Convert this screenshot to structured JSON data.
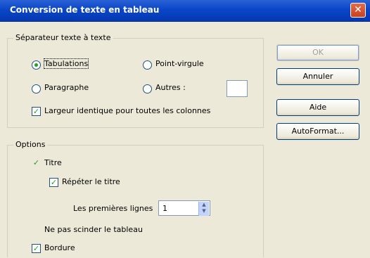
{
  "window": {
    "title": "Conversion de texte en tableau",
    "close_glyph": "✕"
  },
  "separator_group": {
    "legend": "Séparateur texte à texte",
    "tabulations": "Tabulations",
    "point_virgule": "Point-virgule",
    "paragraphe": "Paragraphe",
    "autres": "Autres :",
    "autres_value": "",
    "largeur_identique": "Largeur identique pour toutes les colonnes"
  },
  "options_group": {
    "legend": "Options",
    "titre": "Titre",
    "repeter_titre": "Répéter le titre",
    "premieres_lignes": "Les premières lignes",
    "premieres_lignes_value": "1",
    "ne_pas_scinder": "Ne pas scinder le tableau",
    "bordure": "Bordure"
  },
  "buttons": {
    "ok": "OK",
    "annuler": "Annuler",
    "aide": "Aide",
    "autoformat": "AutoFormat..."
  },
  "state": {
    "separator": "tabulations",
    "largeur_identique": true,
    "titre": true,
    "repeter_titre": true,
    "bordure": true,
    "ne_pas_scinder": false
  },
  "colors": {
    "titlebar": "#0a46c8",
    "dialog_bg": "#ece9d8",
    "check_green": "#21a121"
  }
}
